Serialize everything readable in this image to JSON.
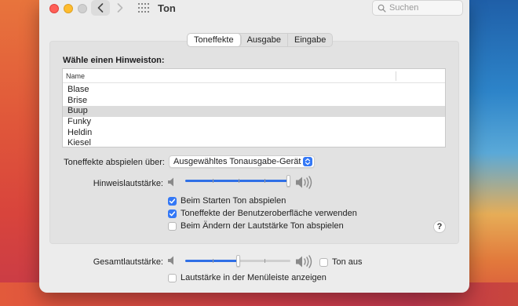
{
  "window": {
    "title": "Ton",
    "search_placeholder": "Suchen"
  },
  "tabs": [
    {
      "label": "Toneffekte",
      "active": true
    },
    {
      "label": "Ausgabe",
      "active": false
    },
    {
      "label": "Eingabe",
      "active": false
    }
  ],
  "alerts": {
    "heading": "Wähle einen Hinweiston:",
    "column_header": "Name",
    "items": [
      "Blase",
      "Brise",
      "Buup",
      "Funky",
      "Heldin",
      "Kiesel"
    ],
    "selected": "Buup"
  },
  "settings": {
    "play_via_label": "Toneffekte abspielen über:",
    "play_via_value": "Ausgewähltes Tonausgabe-Gerät",
    "alert_volume_label": "Hinweislautstärke:",
    "alert_volume_fraction": 1.0,
    "checkboxes": [
      {
        "label": "Beim Starten Ton abspielen",
        "checked": true
      },
      {
        "label": "Toneffekte der Benutzeroberfläche verwenden",
        "checked": true
      },
      {
        "label": "Beim Ändern der Lautstärke Ton abspielen",
        "checked": false
      }
    ],
    "help_label": "?"
  },
  "output": {
    "volume_label": "Gesamtlautstärke:",
    "volume_fraction": 0.5,
    "mute_label": "Ton aus",
    "mute_checked": false,
    "menubar_label": "Lautstärke in der Menüleiste anzeigen",
    "menubar_checked": false
  },
  "colors": {
    "accent": "#3478f6",
    "close": "#ff5f57",
    "minimize": "#febc2e"
  }
}
